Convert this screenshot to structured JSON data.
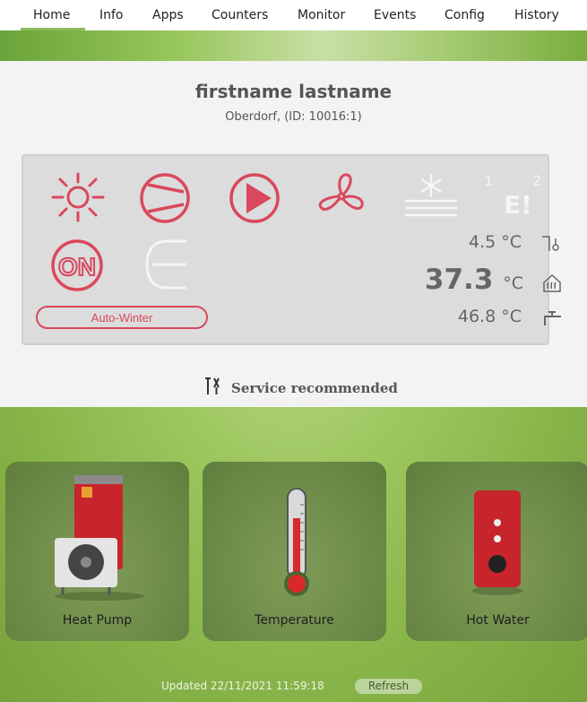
{
  "nav": {
    "items": [
      "Home",
      "Info",
      "Apps",
      "Counters",
      "Monitor",
      "Events",
      "Config",
      "History"
    ],
    "active": "Home"
  },
  "header": {
    "name": "firstname lastname",
    "location": "Oberdorf, (ID: 10016:1)"
  },
  "status": {
    "mode_label": "Auto-Winter",
    "error_text": "E!",
    "error_sub1": "1",
    "error_sub2": "2",
    "outdoor_temp": "4.5",
    "room_temp": "37.3",
    "hot_water_temp": "46.8",
    "unit": "°C",
    "active_color": "#d9485c",
    "inactive_color": "#f4f4f4",
    "icons": [
      "sun-icon",
      "compressor-icon",
      "circulation-pump-icon",
      "fan-icon",
      "defrost-icon",
      "error-icon",
      "on-icon",
      "heating-rod-icon",
      "outdoor-sensor-icon",
      "house-heating-icon",
      "hot-water-tap-icon"
    ]
  },
  "service": {
    "text": "Service recommended",
    "icon": "tools-icon"
  },
  "tiles": [
    {
      "label": "Heat Pump",
      "icon": "heat-pump-icon"
    },
    {
      "label": "Temperature",
      "icon": "thermometer-icon"
    },
    {
      "label": "Hot Water",
      "icon": "water-tank-icon"
    }
  ],
  "footer": {
    "updated": "Updated 22/11/2021 11:59:18",
    "refresh_label": "Refresh"
  }
}
